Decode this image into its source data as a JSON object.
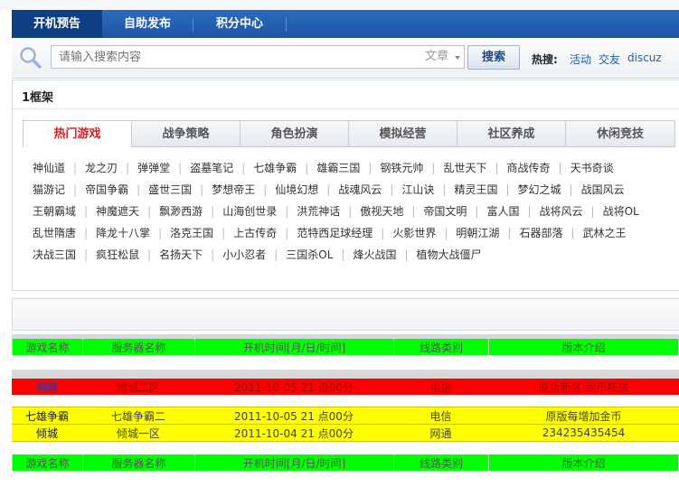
{
  "header": {
    "logo_text": ""
  },
  "nav": {
    "tabs": [
      "开机预告",
      "自助发布",
      "积分中心"
    ]
  },
  "search": {
    "placeholder": "请输入搜索内容",
    "select_value": "文章",
    "button_label": "搜索",
    "hot_label": "热搜:",
    "hot_links": [
      "活动",
      "交友",
      "discuz"
    ]
  },
  "frame": {
    "title": "1框架",
    "tabs": [
      "热门游戏",
      "战争策略",
      "角色扮演",
      "模拟经营",
      "社区养成",
      "休闲竞技"
    ],
    "games": [
      [
        "神仙道",
        "龙之刃",
        "弹弹堂",
        "盗墓笔记",
        "七雄争霸",
        "雄霸三国",
        "钢铁元帅",
        "乱世天下",
        "商战传奇",
        "天书奇谈"
      ],
      [
        "猫游记",
        "帝国争霸",
        "盛世三国",
        "梦想帝王",
        "仙境幻想",
        "战魂风云",
        "江山诀",
        "精灵王国",
        "梦幻之城",
        "战国风云"
      ],
      [
        "王朝霸域",
        "神魔遮天",
        "飘渺西游",
        "山海创世录",
        "洪荒神话",
        "傲视天地",
        "帝国文明",
        "富人国",
        "战将风云",
        "战将OL"
      ],
      [
        "乱世隋唐",
        "降龙十八掌",
        "洛克王国",
        "上古传奇",
        "范特西足球经理",
        "火影世界",
        "明朝江湖",
        "石器部落",
        "武林之王"
      ],
      [
        "决战三国",
        "疯狂松鼠",
        "名扬天下",
        "小小忍者",
        "三国杀OL",
        "烽火战国",
        "植物大战僵尸"
      ]
    ]
  },
  "table": {
    "headers": [
      "游戏名称",
      "服务器名称",
      "开机时间[月/日/时间]",
      "线路类别",
      "版本介绍"
    ],
    "red_row": [
      "倾城",
      "倾城二区",
      "2011-10-05  21 点00分",
      "电信",
      "原版新区 金币狂送"
    ],
    "rows": [
      [
        "七雄争霸",
        "七雄争霸二",
        "2011-10-05   21 点00分",
        "电信",
        "原版每增加金币"
      ],
      [
        "倾城",
        "倾城一区",
        "2011-10-04   21 点00分",
        "网通",
        "234235435454"
      ]
    ]
  },
  "colors": {
    "accent": "#1d5da6",
    "header_row": "#00ff00",
    "red_row": "#ff0000",
    "yellow_row": "#ffff00",
    "active_tab": "#d81e1e"
  }
}
